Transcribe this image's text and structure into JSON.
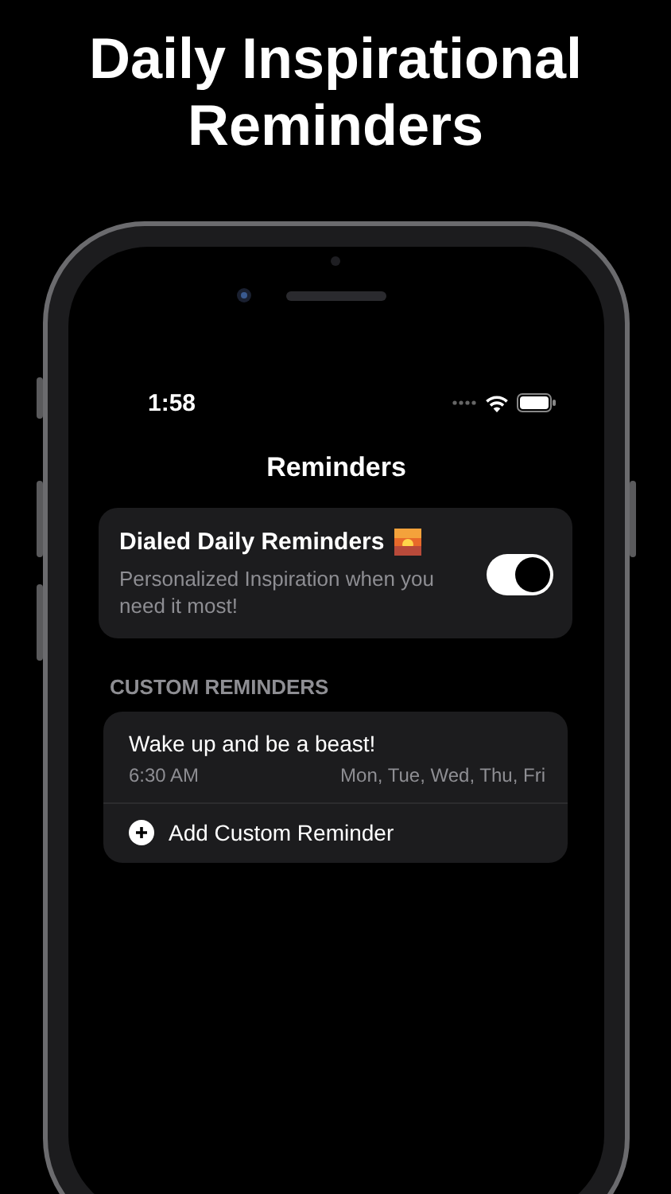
{
  "headline": "Daily Inspirational Reminders",
  "status_bar": {
    "time": "1:58"
  },
  "nav_title": "Reminders",
  "daily": {
    "title": "Dialed Daily Reminders",
    "subtitle": "Personalized Inspiration when you need it most!",
    "on": true
  },
  "section_header": "CUSTOM REMINDERS",
  "reminders": [
    {
      "title": "Wake up and be a beast!",
      "time": "6:30 AM",
      "days": "Mon, Tue, Wed, Thu, Fri"
    }
  ],
  "add_button": {
    "label": "Add Custom Reminder"
  }
}
